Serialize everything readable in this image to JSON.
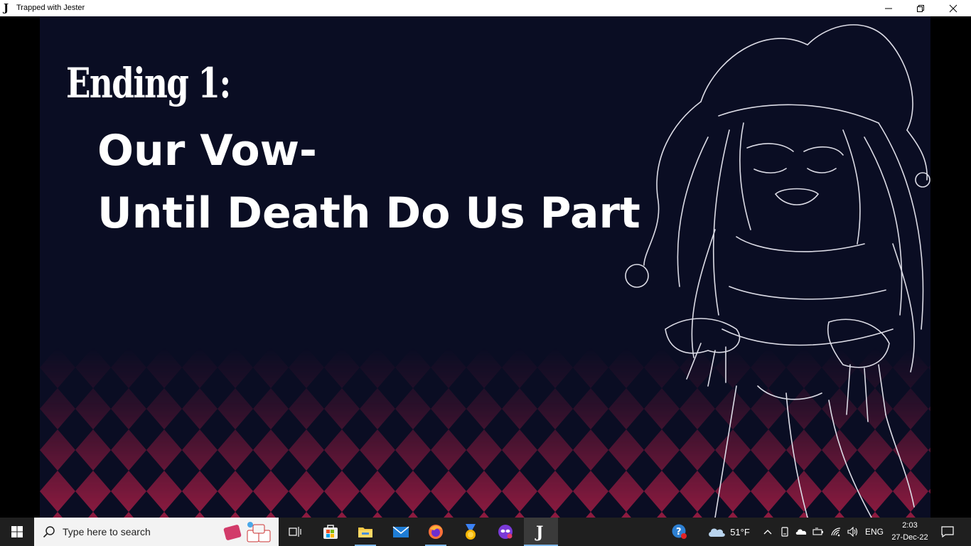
{
  "window": {
    "title": "Trapped with Jester",
    "app_icon_glyph": "J",
    "buttons": [
      "minimize-icon",
      "restore-icon",
      "close-icon"
    ]
  },
  "scene": {
    "ending_label": "Ending 1:",
    "subtitle_line1": "Our Vow-",
    "subtitle_line2": "Until Death Do Us Part",
    "colors": {
      "background": "#0a0d23",
      "diamond_pattern": "#8a1a3c",
      "line_art": "#e8e8ee"
    }
  },
  "taskbar": {
    "search_placeholder": "Type here to search",
    "pinned_apps": [
      {
        "name": "task-view-icon"
      },
      {
        "name": "microsoft-store-icon"
      },
      {
        "name": "file-explorer-icon"
      },
      {
        "name": "mail-icon"
      },
      {
        "name": "firefox-icon"
      },
      {
        "name": "medal-app-icon"
      },
      {
        "name": "mask-app-icon"
      },
      {
        "name": "trapped-with-jester-icon",
        "active": true
      }
    ],
    "tray": {
      "weather_temp": "51°F",
      "language": "ENG",
      "time": "2:03",
      "date": "27-Dec-22"
    }
  }
}
